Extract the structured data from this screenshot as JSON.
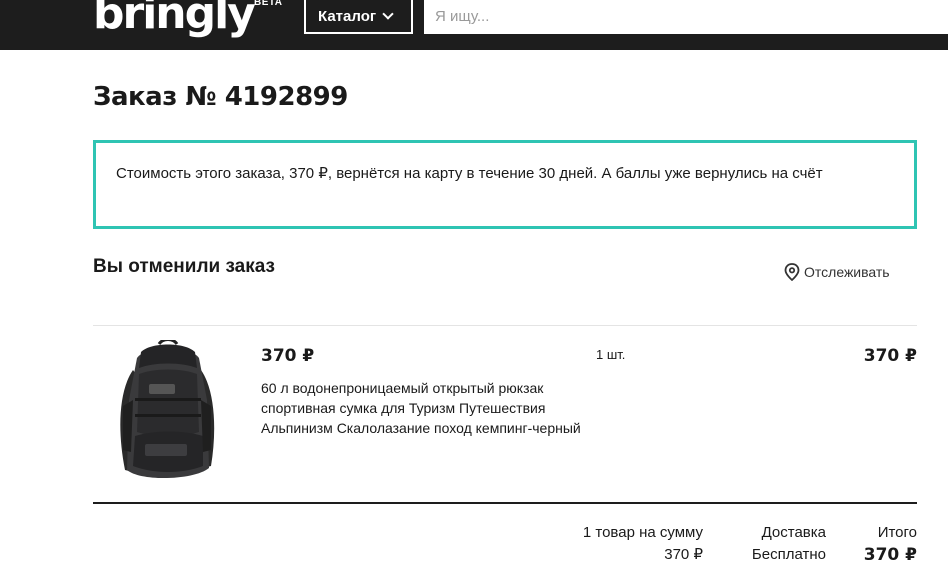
{
  "header": {
    "logo_text": "bringly",
    "beta_badge": "BETA",
    "catalog_label": "Каталог",
    "search_placeholder": "Я ищу..."
  },
  "order": {
    "title": "Заказ № 4192899",
    "notice": "Стоимость этого заказа, 370 ₽, вернётся на карту в течение 30 дней. А баллы уже вернулись на счёт",
    "status": "Вы отменили заказ",
    "track_label": "Отслеживать"
  },
  "item": {
    "price": "370 ₽",
    "name": "60 л водонепроницаемый открытый рюкзак спортивная сумка для Туризм Путешествия Альпинизм Скалолазание поход кемпинг-черный",
    "quantity": "1 шт.",
    "total": "370 ₽"
  },
  "summary": {
    "items_label": "1 товар на сумму",
    "items_value": "370 ₽",
    "delivery_label": "Доставка",
    "delivery_value": "Бесплатно",
    "total_label": "Итого",
    "total_value": "370 ₽"
  },
  "colors": {
    "header_bg": "#1d1d1d",
    "notice_border": "#2fc4b3"
  },
  "icons": {
    "track": "location-pin-icon",
    "catalog": "chevron-down-icon"
  }
}
